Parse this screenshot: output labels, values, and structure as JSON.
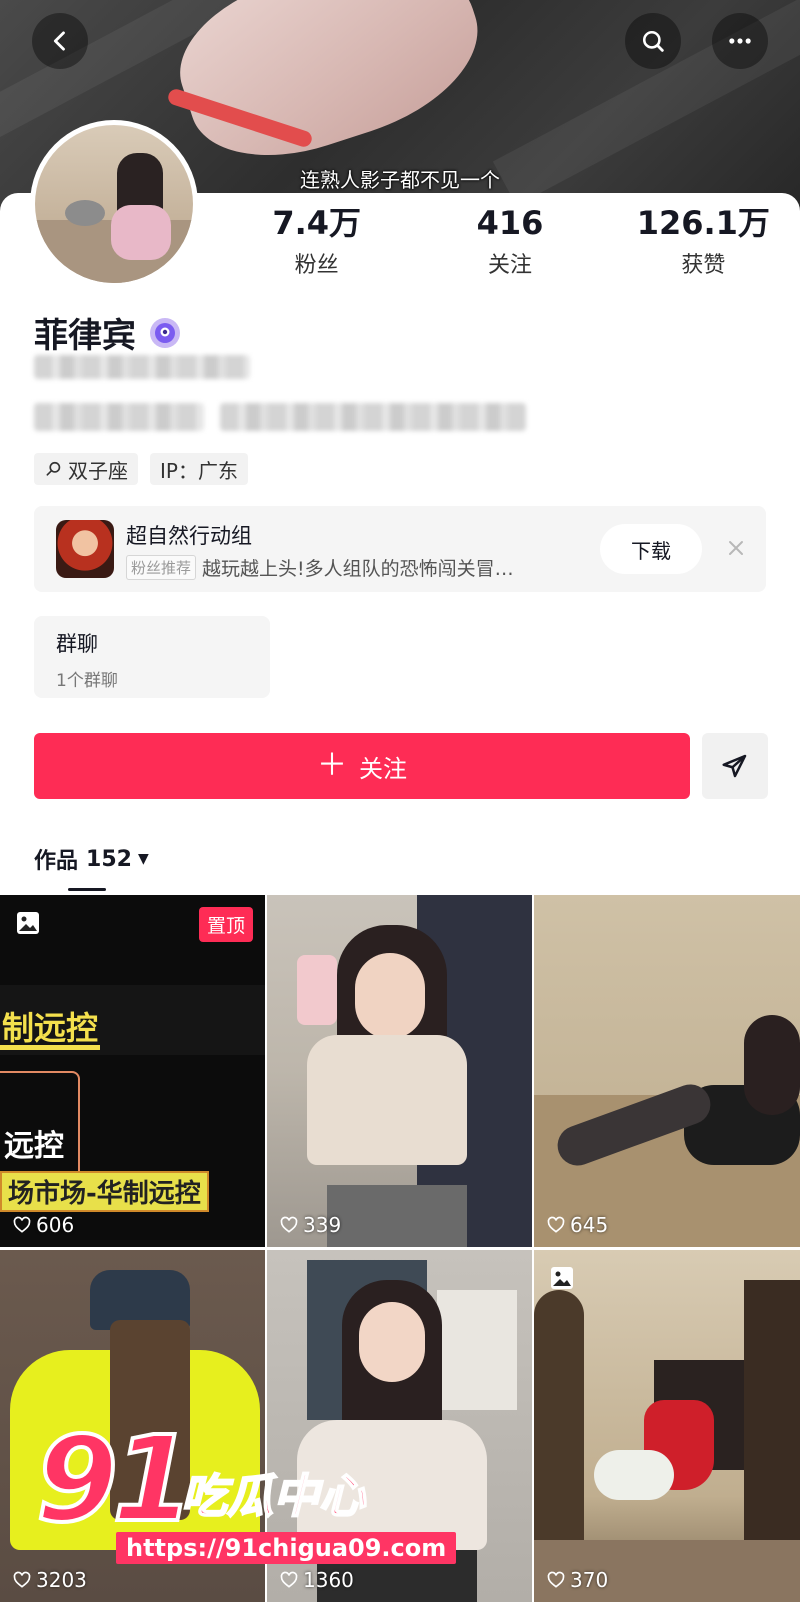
{
  "cover": {
    "caption": "连熟人影子都不见一个"
  },
  "profile": {
    "name": "菲律宾",
    "stats": [
      {
        "value": "7.4万",
        "label": "粉丝"
      },
      {
        "value": "416",
        "label": "关注"
      },
      {
        "value": "126.1万",
        "label": "获赞"
      }
    ],
    "tags": [
      {
        "icon": "search-icon",
        "text": "双子座"
      },
      {
        "text": "IP：广东"
      }
    ]
  },
  "ad": {
    "title": "超自然行动组",
    "chip": "粉丝推荐",
    "description": "越玩越上头!多人组队的恐怖闯关冒…",
    "button": "下载"
  },
  "group_chat": {
    "title": "群聊",
    "subtitle": "1个群聊"
  },
  "actions": {
    "follow_label": "关注",
    "follow_icon": "plus-icon",
    "share_icon": "send-icon"
  },
  "works": {
    "label": "作品",
    "count": "152"
  },
  "grid": [
    {
      "likes": "606",
      "pinned": "置顶",
      "texts": [
        "制远控",
        "远控",
        "场市场-华制远控"
      ]
    },
    {
      "likes": "339"
    },
    {
      "likes": "645"
    },
    {
      "likes": "3203"
    },
    {
      "likes": "1360"
    },
    {
      "likes": "370"
    }
  ],
  "watermark": {
    "number": "91",
    "title": "吃瓜中心",
    "url": "https://91chigua09.com"
  },
  "colors": {
    "accent": "#fe2c55",
    "text": "#161823"
  }
}
